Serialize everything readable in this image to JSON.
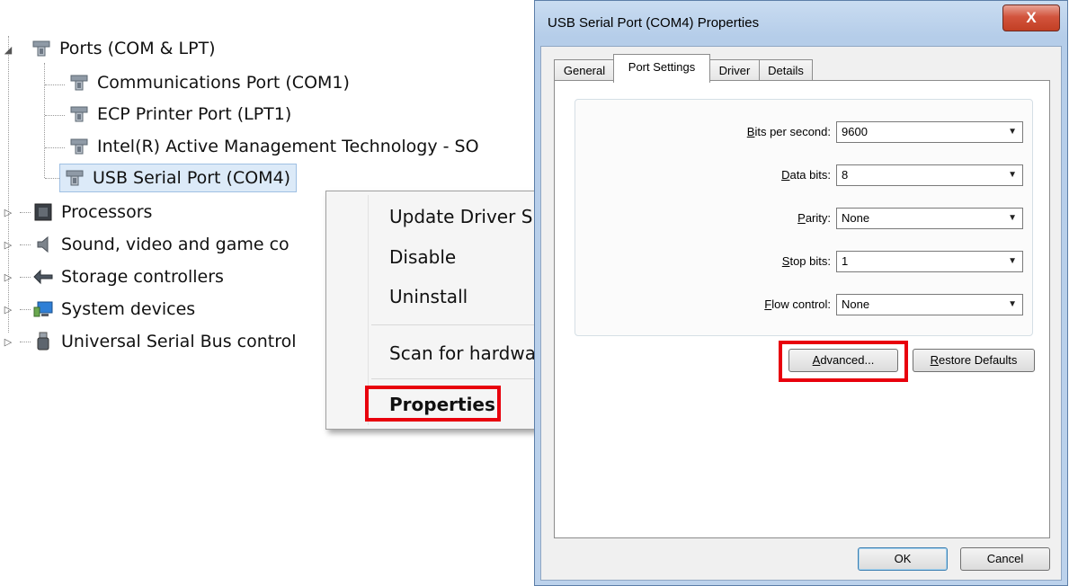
{
  "tree": {
    "items": [
      {
        "label": "Ports (COM & LPT)",
        "icon": "port-icon",
        "expanded": true
      },
      {
        "label": "Communications Port (COM1)",
        "icon": "port-icon"
      },
      {
        "label": "ECP Printer Port (LPT1)",
        "icon": "port-icon"
      },
      {
        "label": "Intel(R) Active Management Technology - SO",
        "icon": "port-icon"
      },
      {
        "label": "USB Serial Port (COM4)",
        "icon": "port-icon",
        "selected": true
      },
      {
        "label": "Processors",
        "icon": "processor-icon"
      },
      {
        "label": "Sound, video and game co",
        "icon": "speaker-icon"
      },
      {
        "label": "Storage controllers",
        "icon": "storage-icon"
      },
      {
        "label": "System devices",
        "icon": "computer-icon"
      },
      {
        "label": "Universal Serial Bus control",
        "icon": "usb-icon"
      }
    ]
  },
  "context_menu": {
    "items": [
      "Update Driver S",
      "Disable",
      "Uninstall",
      "Scan for hardwa",
      "Properties"
    ]
  },
  "dialog": {
    "title": "USB Serial Port (COM4) Properties",
    "close_label": "X",
    "tabs": [
      "General",
      "Port Settings",
      "Driver",
      "Details"
    ],
    "active_tab": "Port Settings",
    "fields": [
      {
        "label_prefix": "",
        "label_underline": "B",
        "label_rest": "its per second:",
        "value": "9600"
      },
      {
        "label_prefix": "",
        "label_underline": "D",
        "label_rest": "ata bits:",
        "value": "8"
      },
      {
        "label_prefix": "",
        "label_underline": "P",
        "label_rest": "arity:",
        "value": "None"
      },
      {
        "label_prefix": "",
        "label_underline": "S",
        "label_rest": "top bits:",
        "value": "1"
      },
      {
        "label_prefix": "",
        "label_underline": "F",
        "label_rest": "low control:",
        "value": "None"
      }
    ],
    "advanced_underline": "A",
    "advanced_rest": "dvanced...",
    "restore_underline": "R",
    "restore_rest": "estore Defaults",
    "ok_label": "OK",
    "cancel_label": "Cancel"
  },
  "colors": {
    "highlight_box": "#e8000d",
    "selection": "#dceaf8",
    "title_bar": "#bcd2ec"
  }
}
